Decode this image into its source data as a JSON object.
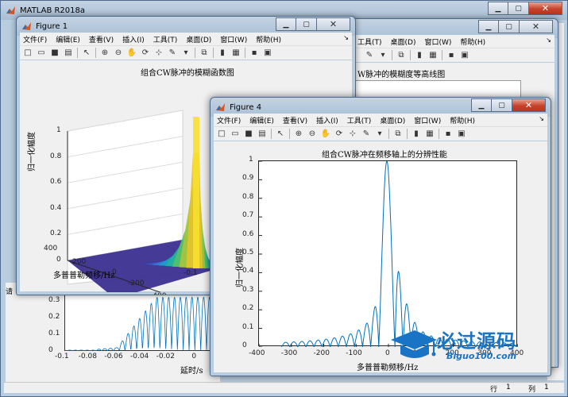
{
  "main_window": {
    "title": "MATLAB R2018a",
    "status_row_label": "行",
    "status_row_value": "1",
    "status_col_label": "列",
    "status_col_value": "1"
  },
  "figure_menu": [
    "文件(F)",
    "编辑(E)",
    "查看(V)",
    "插入(I)",
    "工具(T)",
    "桌面(D)",
    "窗口(W)",
    "帮助(H)"
  ],
  "figure1": {
    "title": "Figure 1",
    "chart_data": {
      "type": "surface",
      "title": "组合CW脉冲的模糊函数图",
      "zlabel": "归一化幅度",
      "ylabel": "多普普勒频移/Hz",
      "zticks": [
        "0",
        "0.2",
        "0.4",
        "0.6",
        "0.8",
        "1"
      ],
      "yticks": [
        "400",
        "200",
        "0",
        "-200",
        "-400"
      ],
      "xticks": [
        "-0.1"
      ],
      "zlim": [
        0,
        1
      ],
      "ylim": [
        -400,
        400
      ]
    }
  },
  "figure2": {
    "title_partial": "W脉冲的模糊度等高线图"
  },
  "figure_bg_bottom": {
    "chart_data": {
      "type": "line",
      "xlabel": "延时/s",
      "xticks": [
        "-0.1",
        "-0.08",
        "-0.06",
        "-0.04",
        "-0.02",
        "0"
      ],
      "yticks": [
        "0.3",
        "0.2",
        "0.1",
        "0"
      ],
      "xlim": [
        -0.1,
        0.02
      ]
    }
  },
  "figure4": {
    "title": "Figure 4",
    "chart_data": {
      "type": "line",
      "title": "组合CW脉冲在频移轴上的分辨性能",
      "xlabel": "多普普勒频移/Hz",
      "ylabel": "归一化幅度",
      "xlim": [
        -400,
        400
      ],
      "ylim": [
        0,
        1
      ],
      "xticks": [
        "-400",
        "-300",
        "-200",
        "-100",
        "0",
        "100",
        "200",
        "300",
        "400"
      ],
      "yticks": [
        "0",
        "0.1",
        "0.2",
        "0.3",
        "0.4",
        "0.5",
        "0.6",
        "0.7",
        "0.8",
        "0.9",
        "1"
      ],
      "mainlobe_center": -5,
      "mainlobe_halfwidth": 25,
      "curve_x_range": [
        -330,
        400
      ]
    }
  },
  "watermark": {
    "text": "必过源码",
    "url": "Biguo100.com"
  },
  "colors": {
    "line": "#0072bd",
    "title_bar": "#b9cde0"
  }
}
